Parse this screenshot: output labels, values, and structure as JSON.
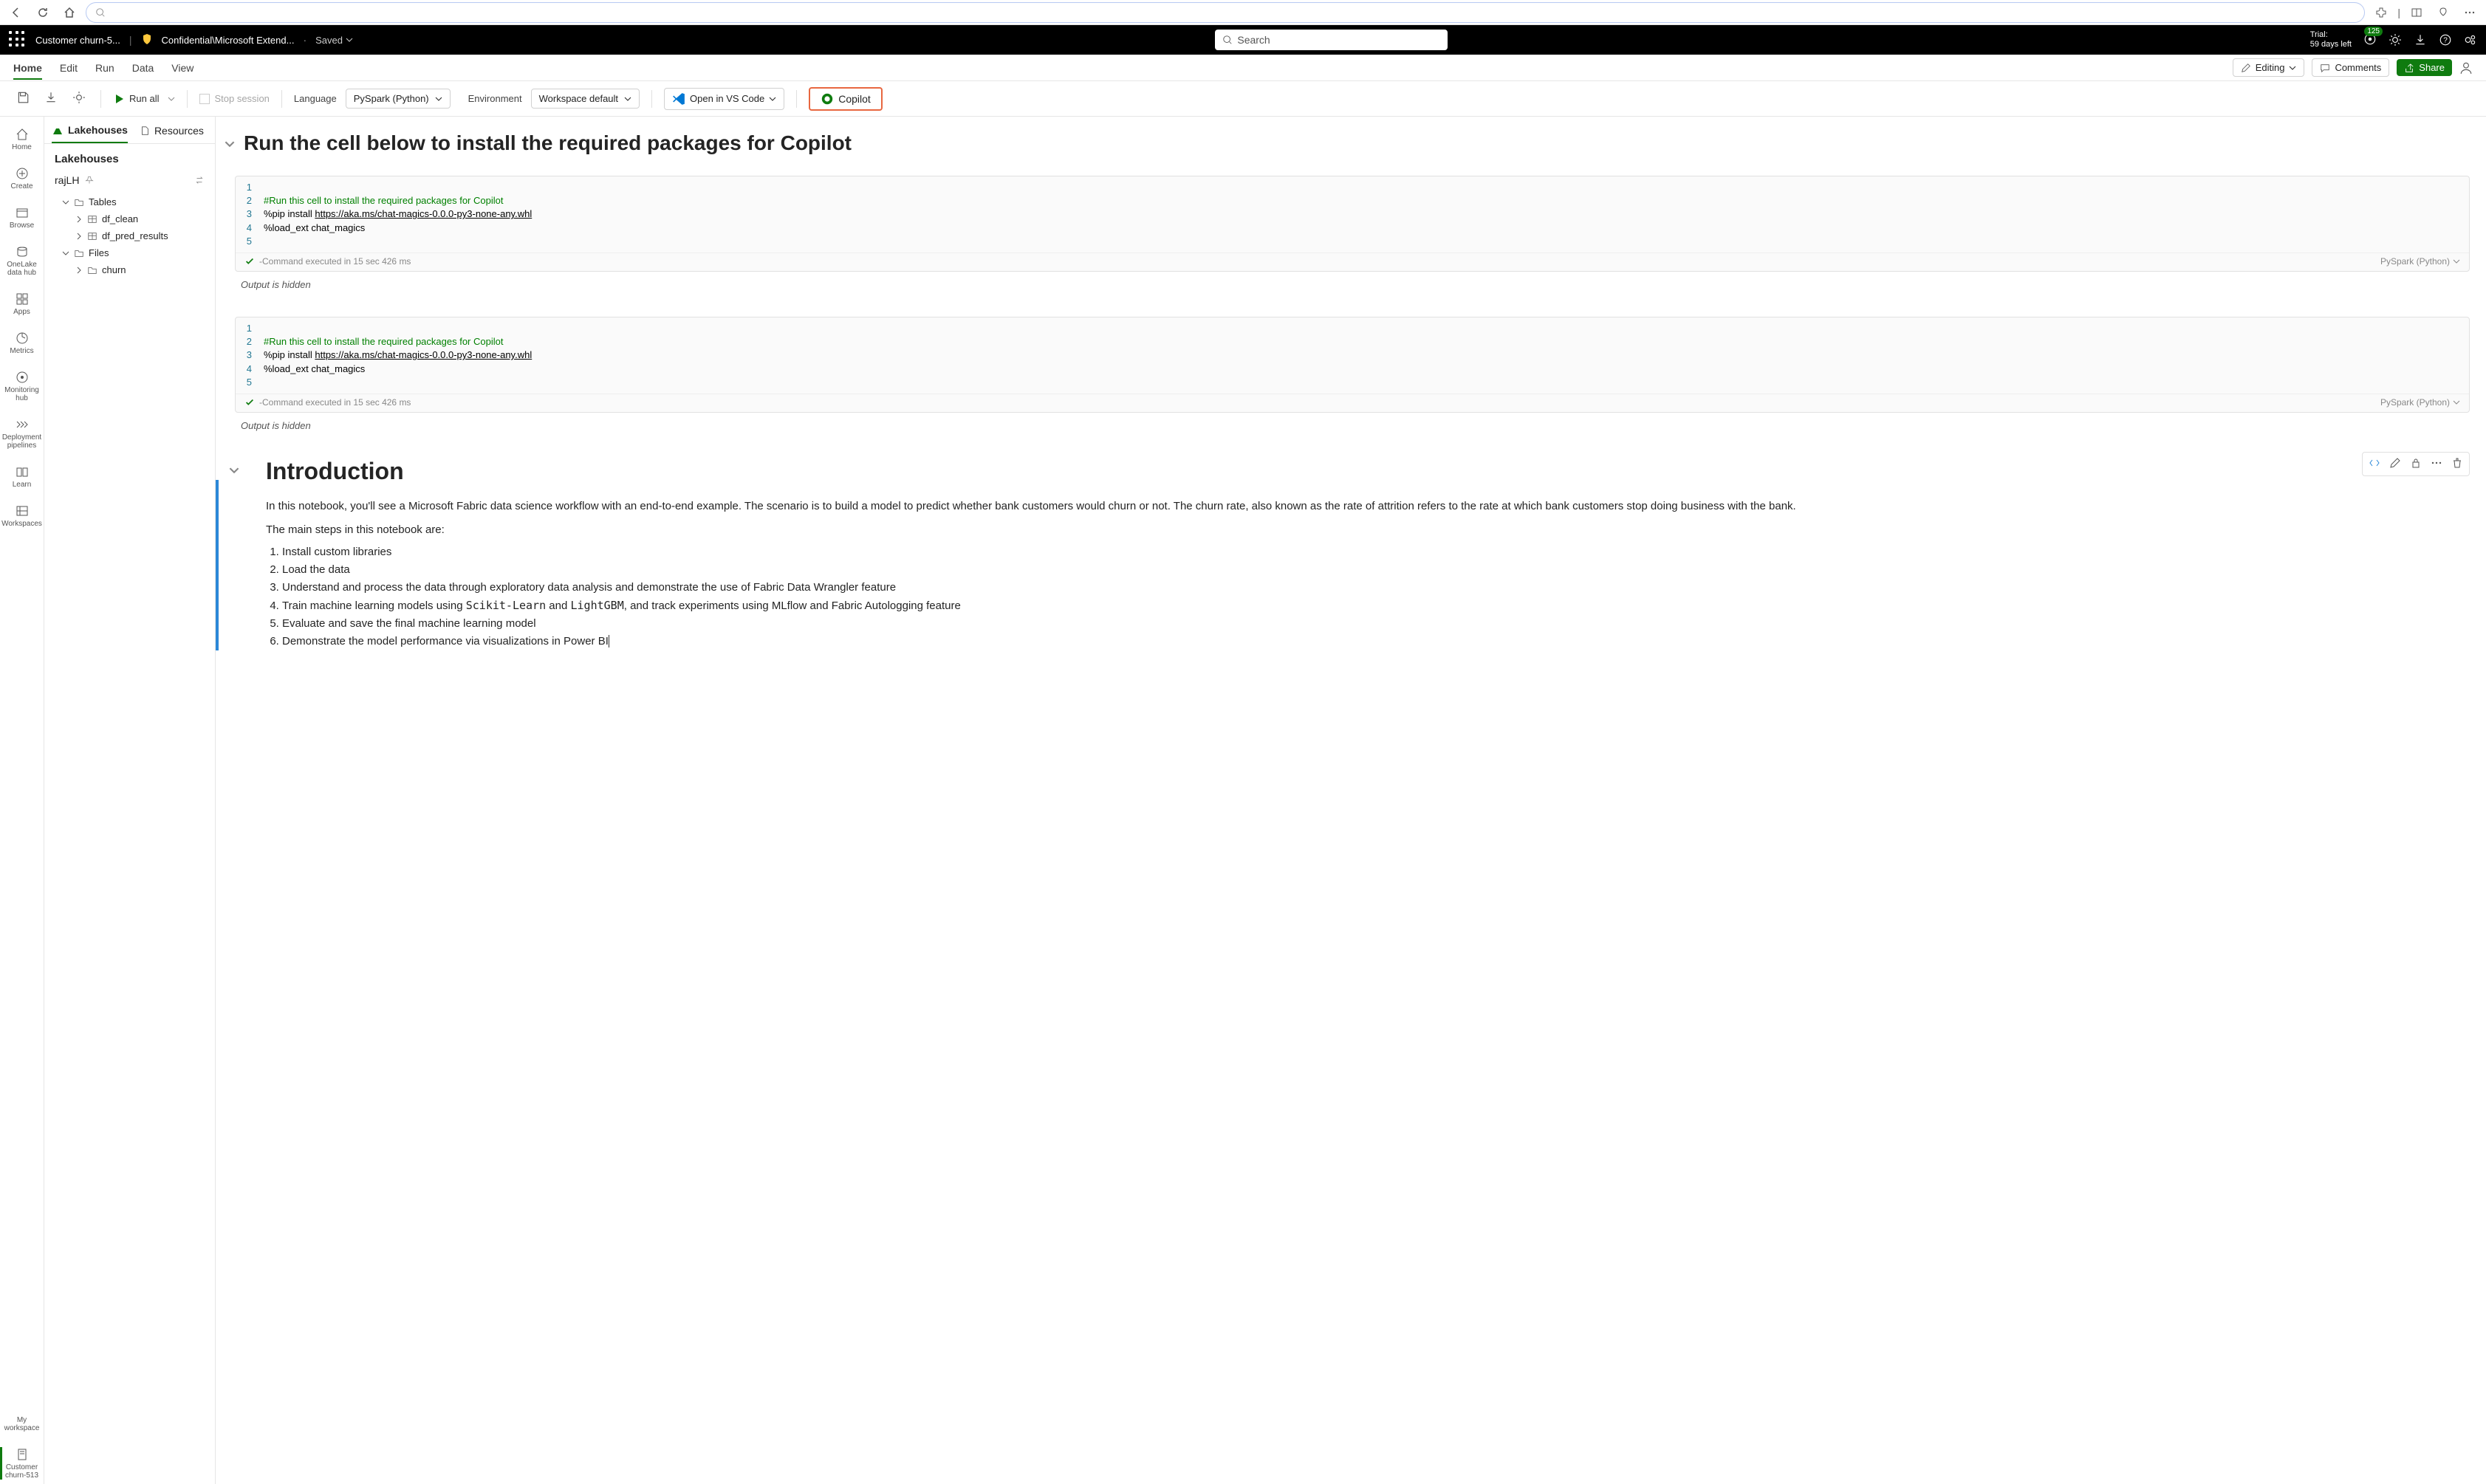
{
  "browser": {
    "search_placeholder": ""
  },
  "header": {
    "app_title": "Customer churn-5...",
    "confidential_label": "Confidential\\Microsoft Extend...",
    "saved_label": "Saved",
    "search_placeholder": "Search",
    "trial_line1": "Trial:",
    "trial_line2": "59 days left",
    "notification_count": "125"
  },
  "tabs": {
    "items": [
      "Home",
      "Edit",
      "Run",
      "Data",
      "View"
    ],
    "editing": "Editing",
    "comments": "Comments",
    "share": "Share"
  },
  "toolbar": {
    "run_all": "Run all",
    "stop_session": "Stop session",
    "language_label": "Language",
    "language_value": "PySpark (Python)",
    "env_label": "Environment",
    "env_value": "Workspace default",
    "vscode": "Open in VS Code",
    "copilot": "Copilot"
  },
  "rail": {
    "items": [
      {
        "label": "Home"
      },
      {
        "label": "Create"
      },
      {
        "label": "Browse"
      },
      {
        "label": "OneLake data hub"
      },
      {
        "label": "Apps"
      },
      {
        "label": "Metrics"
      },
      {
        "label": "Monitoring hub"
      },
      {
        "label": "Deployment pipelines"
      },
      {
        "label": "Learn"
      },
      {
        "label": "Workspaces"
      },
      {
        "label": "My workspace"
      },
      {
        "label": "Customer churn-513"
      }
    ]
  },
  "explorer": {
    "tab_lakehouses": "Lakehouses",
    "tab_resources": "Resources",
    "title": "Lakehouses",
    "lakehouse_name": "rajLH",
    "tables_label": "Tables",
    "files_label": "Files",
    "tables": [
      {
        "name": "df_clean"
      },
      {
        "name": "df_pred_results"
      }
    ],
    "files": [
      {
        "name": "churn"
      }
    ]
  },
  "notebook": {
    "section1_title": "Run the cell below to install the required packages for Copilot",
    "code": {
      "lines": [
        "1",
        "2",
        "3",
        "4",
        "5"
      ],
      "line2": "#Run this cell to install the required packages for Copilot",
      "line3_prefix": "%pip install ",
      "line3_link": "https://aka.ms/chat-magics-0.0.0-py3-none-any.whl",
      "line4": "%load_ext chat_magics"
    },
    "exec_status": "-Command executed in 15 sec 426 ms",
    "cell_lang": "PySpark (Python)",
    "output_hidden": "Output is hidden",
    "intro": {
      "title": "Introduction",
      "para1": "In this notebook, you'll see a Microsoft Fabric data science workflow with an end-to-end example. The scenario is to build a model to predict whether bank customers would churn or not. The churn rate, also known as the rate of attrition refers to the rate at which bank customers stop doing business with the bank.",
      "para2": "The main steps in this notebook are:",
      "steps": [
        "Install custom libraries",
        "Load the data",
        "Understand and process the data through exploratory data analysis and demonstrate the use of Fabric Data Wrangler feature",
        "Train machine learning models using Scikit-Learn and LightGBM, and track experiments using MLflow and Fabric Autologging feature",
        "Evaluate and save the final machine learning model",
        "Demonstrate the model performance via visualizations in Power BI"
      ]
    }
  }
}
